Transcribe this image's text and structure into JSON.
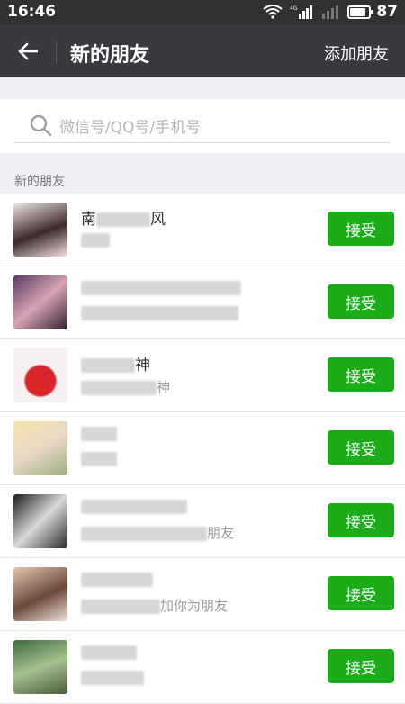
{
  "status_bar": {
    "time": "16:46",
    "battery": "87",
    "battery_level": 0.87,
    "network_label": "4G"
  },
  "header": {
    "back_icon": "arrow-left-icon",
    "title": "新的朋友",
    "add_friend": "添加朋友"
  },
  "search": {
    "icon": "search-icon",
    "placeholder": "微信号/QQ号/手机号"
  },
  "section": {
    "label": "新的朋友"
  },
  "requests": [
    {
      "name": "南",
      "name_suffix": "风",
      "message": "",
      "accept": "接受"
    },
    {
      "name": "",
      "name_suffix": "",
      "message": "",
      "accept": "接受"
    },
    {
      "name": "",
      "name_suffix": "神",
      "message": "神",
      "accept": "接受"
    },
    {
      "name": "",
      "name_suffix": "",
      "message": "",
      "accept": "接受"
    },
    {
      "name": "",
      "name_suffix": "",
      "message": "朋友",
      "accept": "接受"
    },
    {
      "name": "",
      "name_suffix": "",
      "message": "加你为朋友",
      "accept": "接受"
    },
    {
      "name": "",
      "name_suffix": "",
      "message": "",
      "accept": "接受"
    }
  ],
  "colors": {
    "accent": "#1aad19",
    "titlebar": "#393a3f",
    "statusbar": "#2f3133"
  }
}
